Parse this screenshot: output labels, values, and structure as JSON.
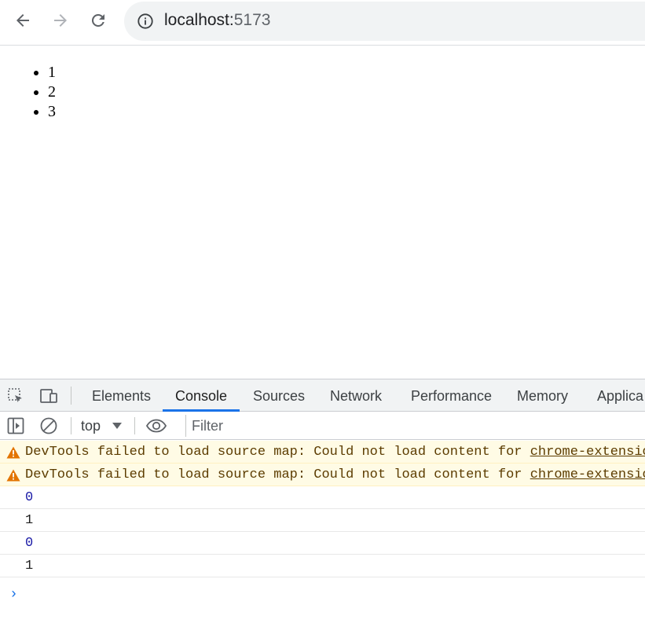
{
  "browser": {
    "url_host": "localhost:",
    "url_port": "5173"
  },
  "page": {
    "list_items": [
      "1",
      "2",
      "3"
    ]
  },
  "devtools": {
    "tabs": [
      "Elements",
      "Console",
      "Sources",
      "Network",
      "Performance",
      "Memory",
      "Applica"
    ],
    "active_tab": "Console",
    "context": "top",
    "filter_placeholder": "Filter",
    "messages": [
      {
        "type": "warning",
        "text": "DevTools failed to load source map: Could not load content for ",
        "link": "chrome-extension:"
      },
      {
        "type": "warning",
        "text": "DevTools failed to load source map: Could not load content for ",
        "link": "chrome-extension:"
      },
      {
        "type": "log",
        "text": "0"
      },
      {
        "type": "log",
        "text": "1"
      },
      {
        "type": "log",
        "text": "0"
      },
      {
        "type": "log",
        "text": "1"
      }
    ],
    "prompt": "›"
  },
  "colors": {
    "accent": "#1a73e8",
    "warning_bg": "#fffbe5",
    "warning_text": "#5c3c00",
    "number": "#1a1aa6"
  }
}
